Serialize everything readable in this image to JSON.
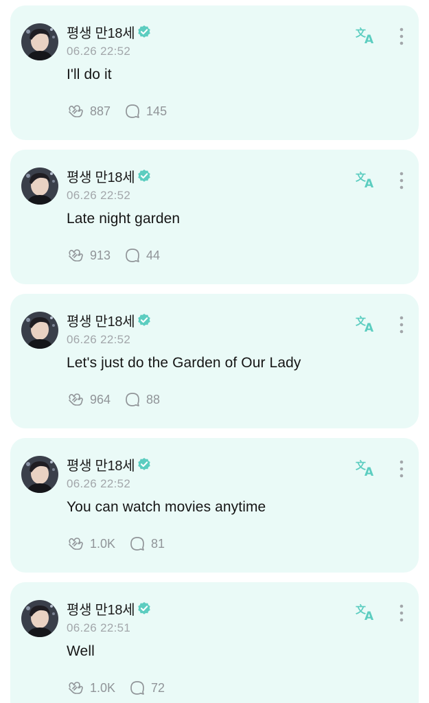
{
  "colors": {
    "card_bg": "#eafaf7",
    "accent": "#5ccdc0",
    "muted": "#909498"
  },
  "icons": {
    "avatar": "profile-photo",
    "verified": "verified-badge-icon",
    "translate": "translate-icon",
    "more": "vertical-dots-icon",
    "like": "heart-hands-icon",
    "comment": "comment-bubble-icon"
  },
  "posts": [
    {
      "author": "평생 만18세",
      "time": "06.26 22:52",
      "text": "I'll do it",
      "likes": "887",
      "comments": "145"
    },
    {
      "author": "평생 만18세",
      "time": "06.26 22:52",
      "text": "Late night garden",
      "likes": "913",
      "comments": "44"
    },
    {
      "author": "평생 만18세",
      "time": "06.26 22:52",
      "text": "Let's just do the Garden of Our Lady",
      "likes": "964",
      "comments": "88"
    },
    {
      "author": "평생 만18세",
      "time": "06.26 22:52",
      "text": "You can watch movies anytime",
      "likes": "1.0K",
      "comments": "81"
    },
    {
      "author": "평생 만18세",
      "time": "06.26 22:51",
      "text": "Well",
      "likes": "1.0K",
      "comments": "72"
    }
  ]
}
